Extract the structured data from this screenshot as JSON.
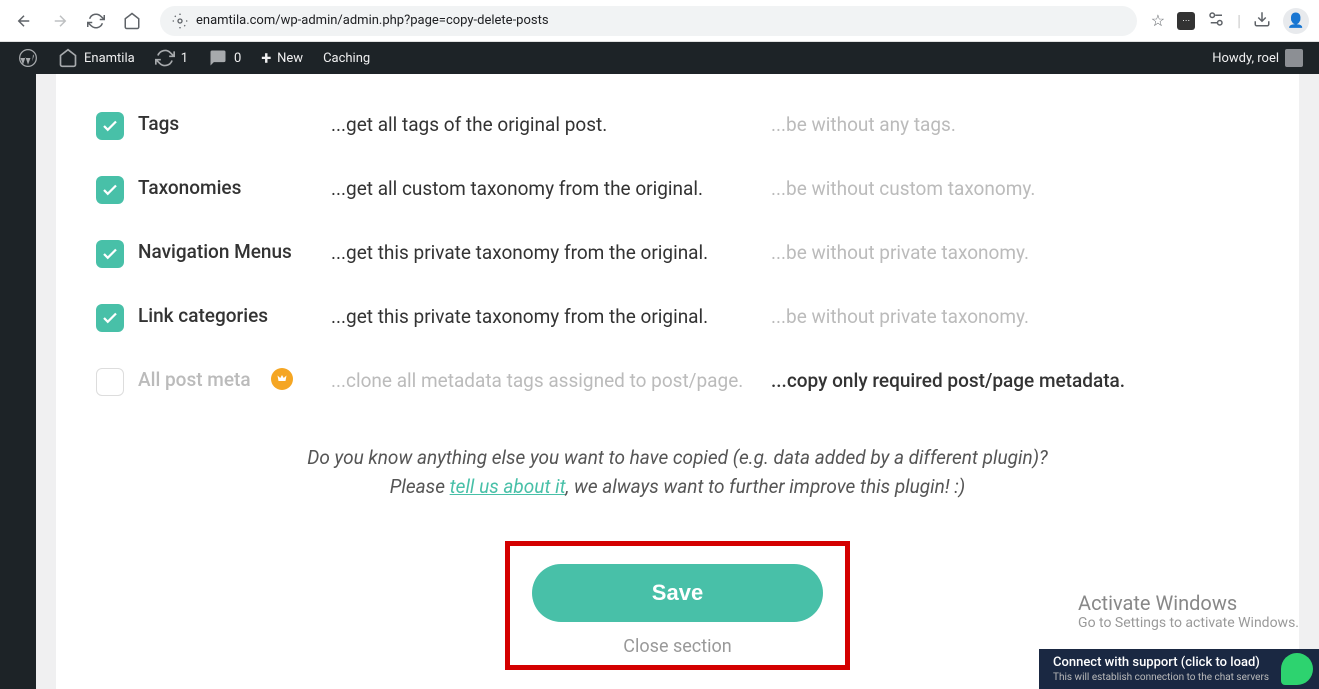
{
  "browser": {
    "url": "enamtila.com/wp-admin/admin.php?page=copy-delete-posts"
  },
  "adminbar": {
    "site": "Enamtila",
    "updates": "1",
    "comments": "0",
    "new": "New",
    "caching": "Caching",
    "greeting": "Howdy, roel"
  },
  "options": [
    {
      "label": "Tags",
      "checked": true,
      "premium": false,
      "active": "...get all tags of the original post.",
      "inactive": "...be without any tags."
    },
    {
      "label": "Taxonomies",
      "checked": true,
      "premium": false,
      "active": "...get all custom taxonomy from the original.",
      "inactive": "...be without custom taxonomy."
    },
    {
      "label": "Navigation Menus",
      "checked": true,
      "premium": false,
      "active": "...get this private taxonomy from the original.",
      "inactive": "...be without private taxonomy."
    },
    {
      "label": "Link categories",
      "checked": true,
      "premium": false,
      "active": "...get this private taxonomy from the original.",
      "inactive": "...be without private taxonomy."
    },
    {
      "label": "All post meta",
      "checked": false,
      "premium": true,
      "active": "...clone all metadata tags assigned to post/page.",
      "inactive": "...copy only required post/page metadata."
    }
  ],
  "feedback": {
    "line1": "Do you know anything else you want to have copied (e.g. data added by a different plugin)?",
    "line2_pre": "Please ",
    "link": "tell us about it",
    "line2_post": ", we always want to further improve this plugin! :)"
  },
  "buttons": {
    "save": "Save",
    "close": "Close section"
  },
  "watermark": {
    "title": "Activate Windows",
    "sub": "Go to Settings to activate Windows."
  },
  "support": {
    "title": "Connect with support (click to load)",
    "sub": "This will establish connection to the chat servers"
  }
}
